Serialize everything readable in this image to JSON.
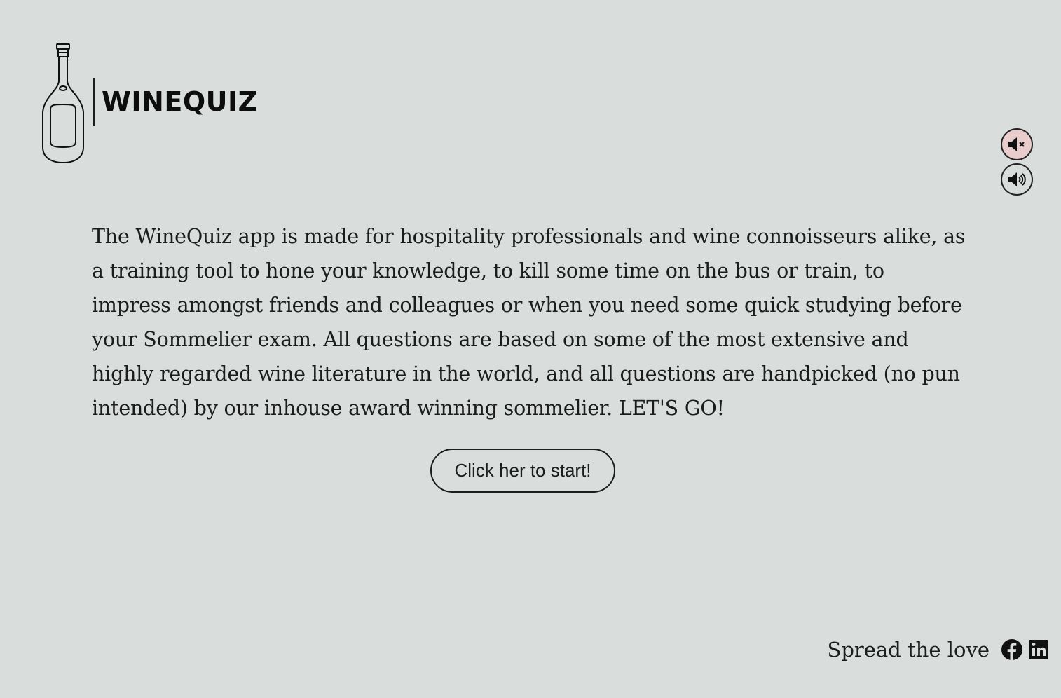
{
  "header": {
    "logo_text": "WINEQUIZ",
    "logo_icon": "wine-bottle-icon"
  },
  "sound_controls": {
    "mute_icon": "speaker-mute-icon",
    "unmute_icon": "speaker-volume-icon",
    "mute_active_color": "#e9cccc"
  },
  "main": {
    "intro_text": "The WineQuiz app is made for hospitality professionals and wine connoisseurs alike, as a training tool to hone your knowledge, to kill some time on the bus or train, to impress amongst friends and colleagues or when you need some quick studying before your Sommelier exam. All questions are based on some of the most extensive and highly regarded wine literature in the world, and all questions are handpicked (no pun intended) by our inhouse award winning sommelier. LET'S GO!",
    "start_button_label": "Click her to start!"
  },
  "footer": {
    "share_text": "Spread the love",
    "social_links": [
      {
        "icon": "facebook-icon"
      },
      {
        "icon": "linkedin-icon"
      }
    ]
  },
  "colors": {
    "background": "#d9dedd",
    "text": "#1c1c1c"
  }
}
